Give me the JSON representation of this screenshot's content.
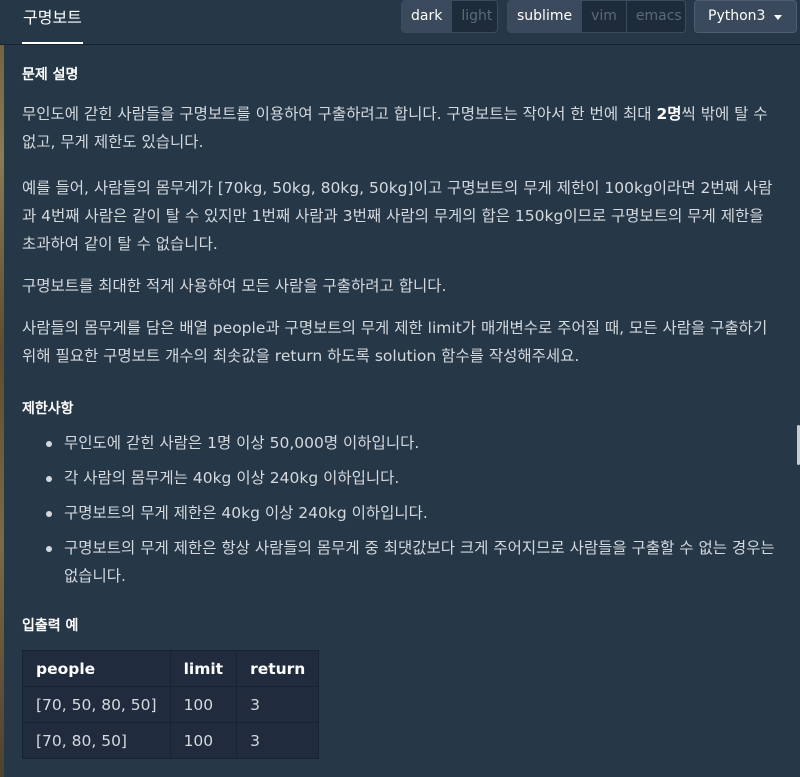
{
  "header": {
    "tab_title": "구명보트",
    "theme": {
      "options": [
        "dark",
        "light"
      ],
      "selected": "dark"
    },
    "keymap": {
      "options": [
        "sublime",
        "vim",
        "emacs"
      ],
      "selected": "sublime"
    },
    "language": {
      "selected": "Python3"
    }
  },
  "problem": {
    "desc_title": "문제 설명",
    "p1_a": "무인도에 갇힌 사람들을 구명보트를 이용하여 구출하려고 합니다. 구명보트는 작아서 한 번에 최대 ",
    "p1_bold": "2명",
    "p1_b": "씩 밖에 탈 수 없고, 무게 제한도 있습니다.",
    "p2": "예를 들어, 사람들의 몸무게가 [70kg, 50kg, 80kg, 50kg]이고 구명보트의 무게 제한이 100kg이라면 2번째 사람과 4번째 사람은 같이 탈 수 있지만 1번째 사람과 3번째 사람의 무게의 합은 150kg이므로 구명보트의 무게 제한을 초과하여 같이 탈 수 없습니다.",
    "p3": "구명보트를 최대한 적게 사용하여 모든 사람을 구출하려고 합니다.",
    "p4": "사람들의 몸무게를 담은 배열 people과 구명보트의 무게 제한 limit가 매개변수로 주어질 때, 모든 사람을 구출하기 위해 필요한 구명보트 개수의 최솟값을 return 하도록 solution 함수를 작성해주세요.",
    "constraints_title": "제한사항",
    "constraints": [
      "무인도에 갇힌 사람은 1명 이상 50,000명 이하입니다.",
      "각 사람의 몸무게는 40kg 이상 240kg 이하입니다.",
      "구명보트의 무게 제한은 40kg 이상 240kg 이하입니다.",
      "구명보트의 무게 제한은 항상 사람들의 몸무게 중 최댓값보다 크게 주어지므로 사람들을 구출할 수 없는 경우는 없습니다."
    ],
    "examples_title": "입출력 예",
    "table": {
      "headers": [
        "people",
        "limit",
        "return"
      ],
      "rows": [
        [
          "[70, 50, 80, 50]",
          "100",
          "3"
        ],
        [
          "[70, 80, 50]",
          "100",
          "3"
        ]
      ]
    }
  }
}
